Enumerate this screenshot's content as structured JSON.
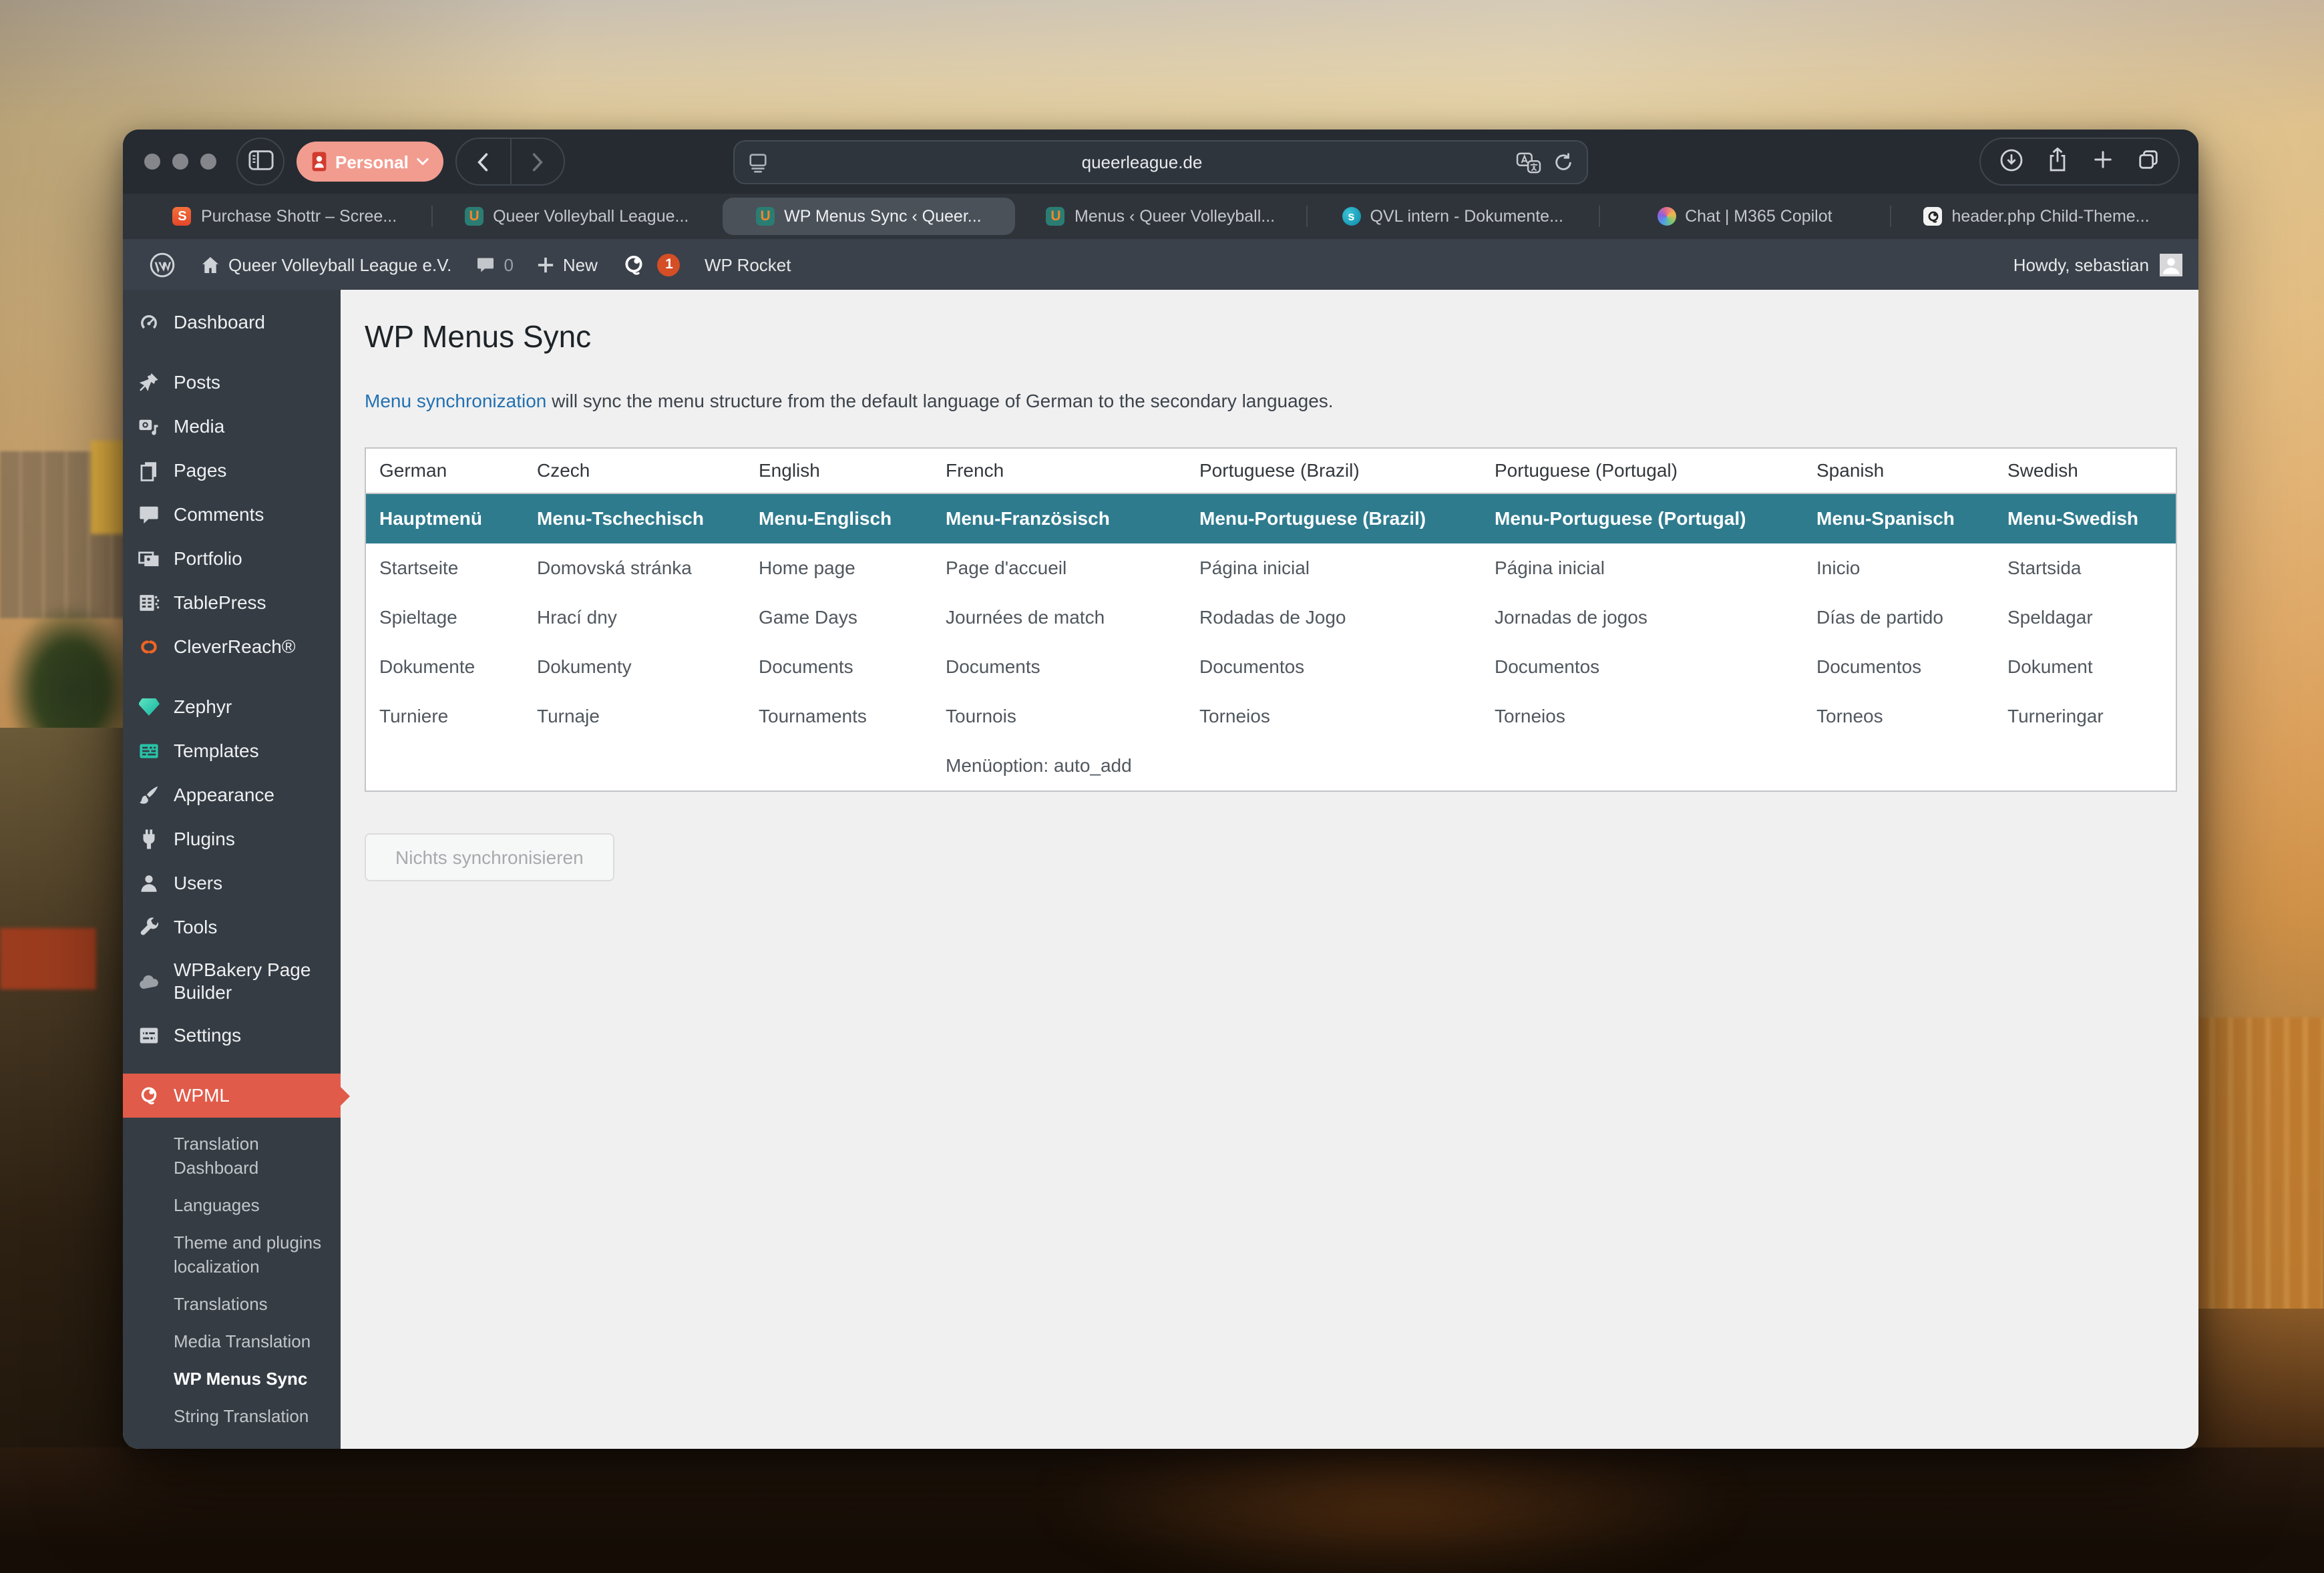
{
  "colors": {
    "wpml_red": "#e05b4a",
    "menu_row_teal": "#2f7b8e",
    "link_blue": "#2271b1",
    "badge_orange": "#d54e26",
    "profile_pill_salmon": "#f29c90"
  },
  "browser": {
    "profile_label": "Personal",
    "url": "queerleague.de",
    "toolbar_icons": [
      "sidebar-toggle-icon",
      "back-icon",
      "forward-icon",
      "page-settings-icon",
      "translate-icon",
      "reload-icon",
      "download-icon",
      "share-icon",
      "new-tab-icon",
      "tab-overview-icon"
    ],
    "tabs": [
      {
        "icon": "shottr-favicon",
        "label": "Purchase Shottr – Scree..."
      },
      {
        "icon": "qvl-favicon",
        "label": "Queer Volleyball League..."
      },
      {
        "icon": "qvl-favicon",
        "label": "WP Menus Sync ‹ Queer...",
        "active": true
      },
      {
        "icon": "qvl-favicon",
        "label": "Menus ‹ Queer Volleyball..."
      },
      {
        "icon": "sharepoint-favicon",
        "label": "QVL intern - Dokumente..."
      },
      {
        "icon": "copilot-favicon",
        "label": "Chat | M365 Copilot"
      },
      {
        "icon": "wpml-doc-favicon",
        "label": "header.php Child-Theme..."
      }
    ]
  },
  "admin_bar": {
    "site_name": "Queer Volleyball League e.V.",
    "comments_count": "0",
    "new_label": "New",
    "wpml_badge": "1",
    "wp_rocket_label": "WP Rocket",
    "howdy": "Howdy, sebastian"
  },
  "sidebar": {
    "items": [
      {
        "icon": "dashboard-icon",
        "label": "Dashboard"
      },
      {
        "separator": true
      },
      {
        "icon": "pin-icon",
        "label": "Posts"
      },
      {
        "icon": "media-icon",
        "label": "Media"
      },
      {
        "icon": "pages-icon",
        "label": "Pages"
      },
      {
        "icon": "comments-icon",
        "label": "Comments"
      },
      {
        "icon": "portfolio-icon",
        "label": "Portfolio"
      },
      {
        "icon": "tablepress-icon",
        "label": "TablePress"
      },
      {
        "icon": "cleverreach-icon",
        "label": "CleverReach®"
      },
      {
        "separator": true
      },
      {
        "icon": "zephyr-icon",
        "label": "Zephyr"
      },
      {
        "icon": "templates-icon",
        "label": "Templates"
      },
      {
        "icon": "appearance-icon",
        "label": "Appearance"
      },
      {
        "icon": "plugins-icon",
        "label": "Plugins"
      },
      {
        "icon": "users-icon",
        "label": "Users"
      },
      {
        "icon": "tools-icon",
        "label": "Tools"
      },
      {
        "icon": "wpbakery-icon",
        "label": "WPBakery Page Builder"
      },
      {
        "icon": "settings-icon",
        "label": "Settings"
      },
      {
        "separator": true
      },
      {
        "icon": "wpml-icon",
        "label": "WPML",
        "active": true
      }
    ],
    "wpml_submenu": [
      {
        "label": "Translation Dashboard"
      },
      {
        "label": "Languages"
      },
      {
        "label": "Theme and plugins localization"
      },
      {
        "label": "Translations"
      },
      {
        "label": "Media Translation"
      },
      {
        "label": "WP Menus Sync",
        "current": true
      },
      {
        "label": "String Translation"
      }
    ]
  },
  "page": {
    "title": "WP Menus Sync",
    "intro_link": "Menu synchronization",
    "intro_rest": " will sync the menu structure from the default language of German to the secondary languages.",
    "button_label": "Nichts synchronisieren"
  },
  "table": {
    "headers": [
      "German",
      "Czech",
      "English",
      "French",
      "Portuguese (Brazil)",
      "Portuguese (Portugal)",
      "Spanish",
      "Swedish"
    ],
    "menu_row": [
      "Hauptmenü",
      "Menu-Tschechisch",
      "Menu-Englisch",
      "Menu-Französisch",
      "Menu-Portuguese (Brazil)",
      "Menu-Portuguese (Portugal)",
      "Menu-Spanisch",
      "Menu-Swedish"
    ],
    "rows": [
      [
        "Startseite",
        "Domovská stránka",
        "Home page",
        "Page d'accueil",
        "Página inicial",
        "Página inicial",
        "Inicio",
        "Startsida"
      ],
      [
        "Spieltage",
        "Hrací dny",
        "Game Days",
        "Journées de match",
        "Rodadas de Jogo",
        "Jornadas de jogos",
        "Días de partido",
        "Speldagar"
      ],
      [
        "Dokumente",
        "Dokumenty",
        "Documents",
        "Documents",
        "Documentos",
        "Documentos",
        "Documentos",
        "Dokument"
      ],
      [
        "Turniere",
        "Turnaje",
        "Tournaments",
        "Tournois",
        "Torneios",
        "Torneios",
        "Torneos",
        "Turneringar"
      ],
      [
        "",
        "",
        "",
        "Menüoption: auto_add",
        "",
        "",
        "",
        ""
      ]
    ]
  }
}
